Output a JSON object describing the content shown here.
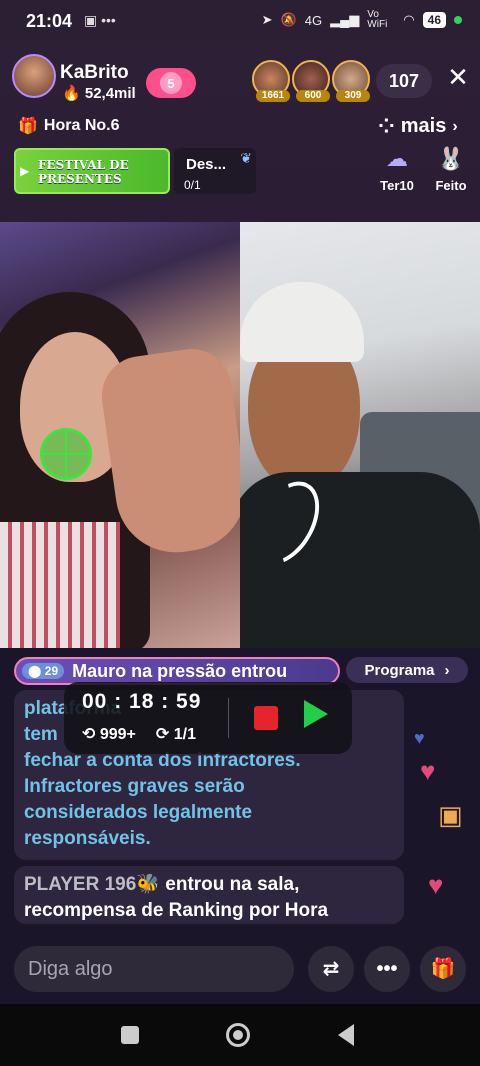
{
  "status_bar": {
    "time": "21:04",
    "network": "4G",
    "vowifi": "Vo WiFi",
    "battery": "46"
  },
  "header": {
    "host_name": "KaBrito",
    "host_fans": "52,4mil",
    "host_level": "5",
    "top_viewers": [
      {
        "score": "1661"
      },
      {
        "score": "600"
      },
      {
        "score": "309"
      }
    ],
    "viewer_count": "107",
    "close_label": "✕",
    "hour_rank": "Hora No.6",
    "more_label": "mais"
  },
  "events": {
    "festival_label": "FESTIVAL DE PRESENTES",
    "task_title": "Des...",
    "task_progress": "0/1",
    "side_buttons": [
      {
        "label": "Ter10"
      },
      {
        "label": "Feito"
      }
    ]
  },
  "entry": {
    "level": "29",
    "message": "Mauro na pressão entrou",
    "program_label": "Programa"
  },
  "chat": {
    "notice_lines": [
      "plataforma",
      "tem",
      "fechar a conta dos infractores.",
      "Infractores graves serão",
      "considerados legalmente",
      "responsáveis."
    ],
    "player_name": "PLAYER 196",
    "player_text": "entrou na sala,",
    "player_text2": "recompensa de Ranking por Hora"
  },
  "recorder": {
    "time": "00 : 18 : 59",
    "repeat_count": "999+",
    "loop_count": "1/1"
  },
  "bottom": {
    "input_placeholder": "Diga algo",
    "more_label": "•••"
  },
  "colors": {
    "accent_pink": "#ff4f8b",
    "rec_red": "#e5242b",
    "rec_green": "#20d048",
    "chat_blue": "#72c2e8"
  }
}
